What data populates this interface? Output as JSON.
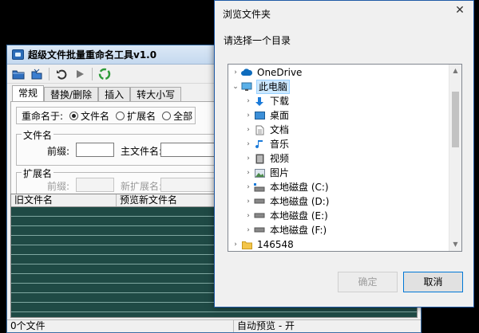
{
  "app": {
    "title": "超级文件批量重命名工具v1.0",
    "tabs": [
      "常规",
      "替换/删除",
      "插入",
      "转大小写"
    ],
    "rename_label": "重命名于:",
    "rename_options": [
      "文件名",
      "扩展名",
      "全部"
    ],
    "rename_selected": "文件名",
    "filename_group": {
      "title": "文件名",
      "prefix_label": "前缀:",
      "prefix_value": "",
      "main_label": "主文件名:",
      "main_value": ""
    },
    "ext_group": {
      "title": "扩展名",
      "prefix_label": "前缀:",
      "new_ext_label": "新扩展名:"
    },
    "list_columns": [
      "旧文件名",
      "预览新文件名"
    ],
    "status": {
      "file_count": "0个文件",
      "auto_preview": "自动预览 - 开"
    },
    "toolbar_icons": [
      "open-folder-icon",
      "save-icon",
      "undo-icon",
      "run-icon",
      "recycle-icon"
    ]
  },
  "dialog": {
    "title": "浏览文件夹",
    "prompt": "请选择一个目录",
    "close_glyph": "✕",
    "tree": [
      {
        "label": "OneDrive",
        "icon": "cloud-icon",
        "expander": "›",
        "level": 0
      },
      {
        "label": "此电脑",
        "icon": "computer-icon",
        "expander": "⌄",
        "level": 0,
        "selected": true
      },
      {
        "label": "下载",
        "icon": "download-icon",
        "expander": "›",
        "level": 1
      },
      {
        "label": "桌面",
        "icon": "desktop-icon",
        "expander": "›",
        "level": 1
      },
      {
        "label": "文档",
        "icon": "document-icon",
        "expander": "›",
        "level": 1
      },
      {
        "label": "音乐",
        "icon": "music-icon",
        "expander": "›",
        "level": 1
      },
      {
        "label": "视频",
        "icon": "video-icon",
        "expander": "›",
        "level": 1
      },
      {
        "label": "图片",
        "icon": "picture-icon",
        "expander": "›",
        "level": 1
      },
      {
        "label": "本地磁盘 (C:)",
        "icon": "system-drive-icon",
        "expander": "›",
        "level": 1
      },
      {
        "label": "本地磁盘 (D:)",
        "icon": "drive-icon",
        "expander": "›",
        "level": 1
      },
      {
        "label": "本地磁盘 (E:)",
        "icon": "drive-icon",
        "expander": "›",
        "level": 1
      },
      {
        "label": "本地磁盘 (F:)",
        "icon": "drive-icon",
        "expander": "›",
        "level": 1
      },
      {
        "label": "146548",
        "icon": "folder-icon",
        "expander": "›",
        "level": 0
      }
    ],
    "ok_label": "确定",
    "cancel_label": "取消"
  }
}
